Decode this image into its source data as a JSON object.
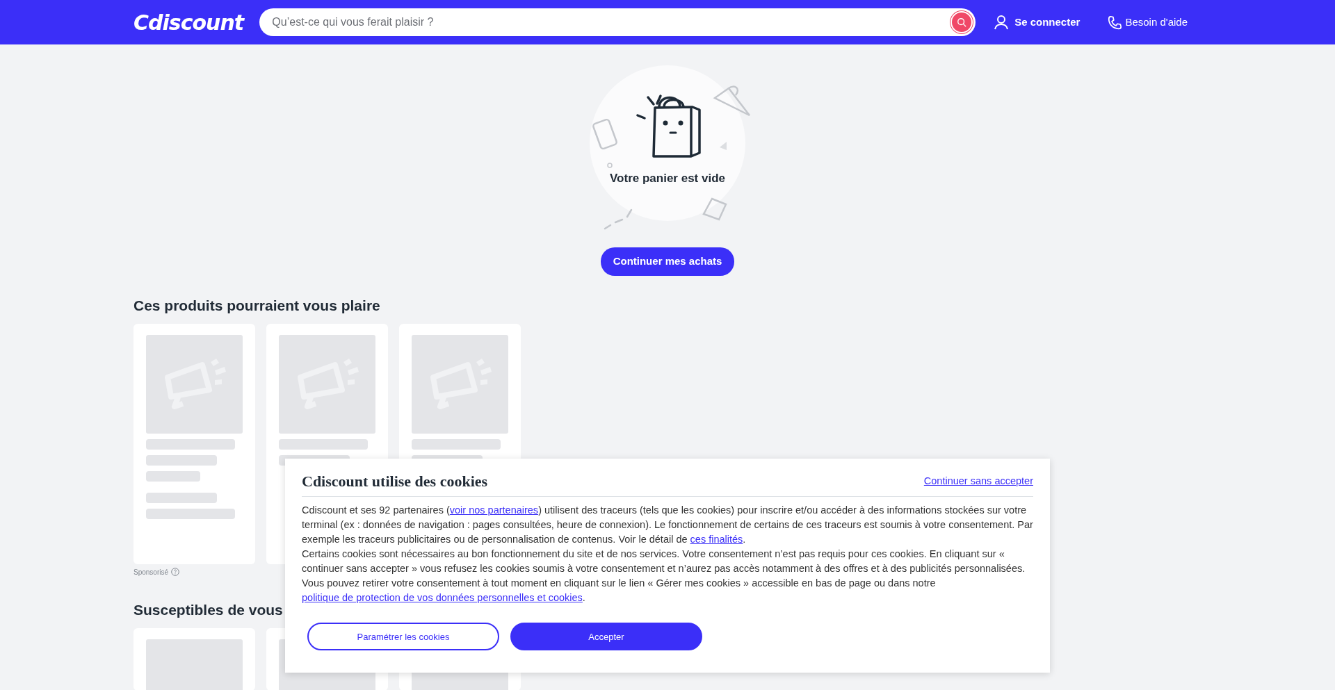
{
  "header": {
    "logo": "Cdiscount",
    "search": {
      "placeholder": "Qu’est-ce qui vous ferait plaisir ?"
    },
    "login": "Se connecter",
    "help": "Besoin d'aide"
  },
  "empty_cart": {
    "message": "Votre panier est vide",
    "button": "Continuer mes achats"
  },
  "sections": [
    {
      "title": "Ces produits pourraient vous plaire",
      "sponsored_label": "Sponsorisé"
    },
    {
      "title": "Susceptibles de vous"
    }
  ],
  "cookie_banner": {
    "title": "Cdiscount utilise des cookies",
    "skip_link": "Continuer sans accepter",
    "paragraphs": [
      [
        {
          "kind": "text",
          "text": "Cdiscount et ses 92 partenaires ("
        },
        {
          "kind": "link",
          "text": "voir nos partenaires"
        },
        {
          "kind": "text",
          "text": ") utilisent des traceurs (tels que les cookies) pour inscrire et/ou accéder à des informations stockées sur votre terminal (ex : données de navigation : pages consultées, heure de connexion). Le fonctionnement de certains de ces traceurs est soumis à votre consentement. Par exemple les traceurs publicitaires ou de personnalisation de contenus. Voir le détail de "
        },
        {
          "kind": "link",
          "text": "ces finalités"
        },
        {
          "kind": "text",
          "text": "."
        }
      ],
      [
        {
          "kind": "text",
          "text": "Certains cookies sont nécessaires au bon fonctionnement du site et de nos services. Votre consentement n’est pas requis pour ces cookies. En cliquant sur « continuer sans accepter » vous refusez les cookies soumis à votre consentement et n’aurez pas accès notamment à des offres et à des publicités personnalisées."
        }
      ],
      [
        {
          "kind": "text",
          "text": "Vous pouvez retirer votre consentement à tout moment en cliquant sur le lien « Gérer mes cookies » accessible en bas de page ou dans notre "
        },
        {
          "kind": "link",
          "text": "politique de protection de vos données personnelles et cookies"
        },
        {
          "kind": "text",
          "text": "."
        }
      ]
    ],
    "buttons": [
      {
        "label": "Paramétrer les cookies",
        "kind": "outline"
      },
      {
        "label": "Accepter",
        "kind": "primary"
      }
    ]
  }
}
